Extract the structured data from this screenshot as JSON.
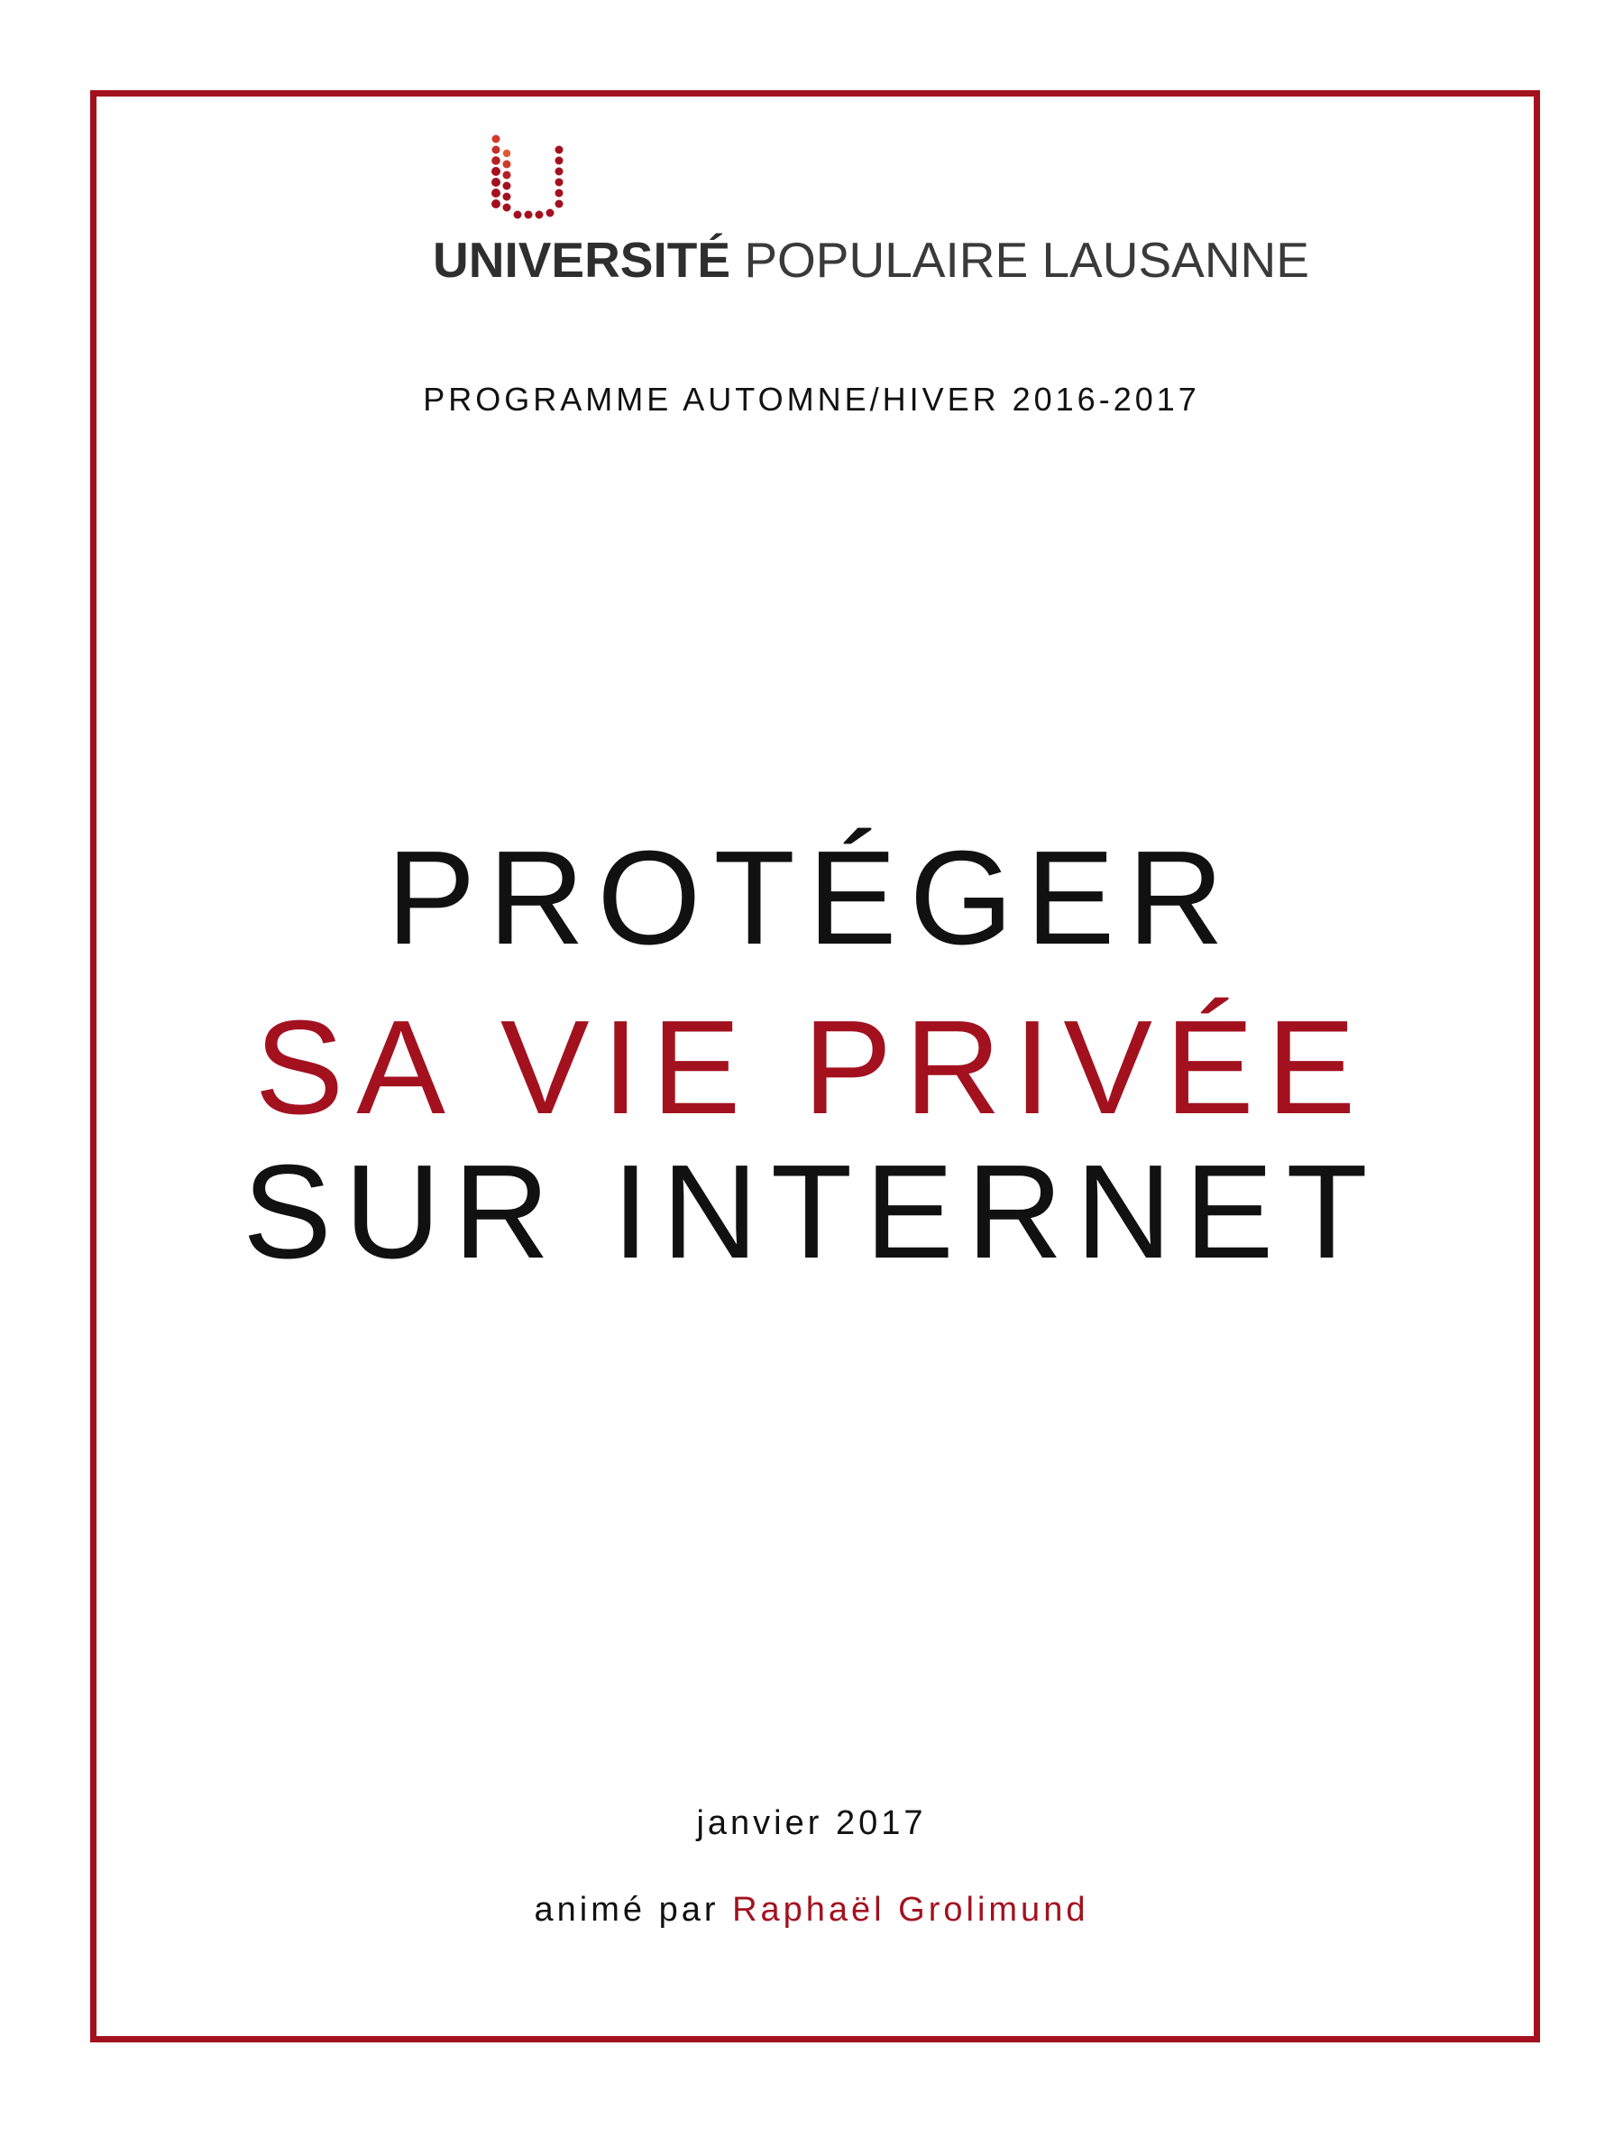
{
  "logo": {
    "name_strong": "UNIVERSITÉ",
    "name_light": "POPULAIRE LAUSANNE"
  },
  "program": "PROGRAMME AUTOMNE/HIVER 2016-2017",
  "title": {
    "line1": "PROTÉGER",
    "line2": "SA VIE PRIVÉE",
    "line3": "SUR INTERNET"
  },
  "date": "janvier 2017",
  "host": {
    "prefix": "animé par",
    "name": "Raphaël Grolimund"
  },
  "colors": {
    "accent": "#a3111f",
    "text": "#111111",
    "logo_text": "#3a3a3a"
  },
  "icons": {
    "logo_mark": "dotted-u-logo-icon"
  }
}
